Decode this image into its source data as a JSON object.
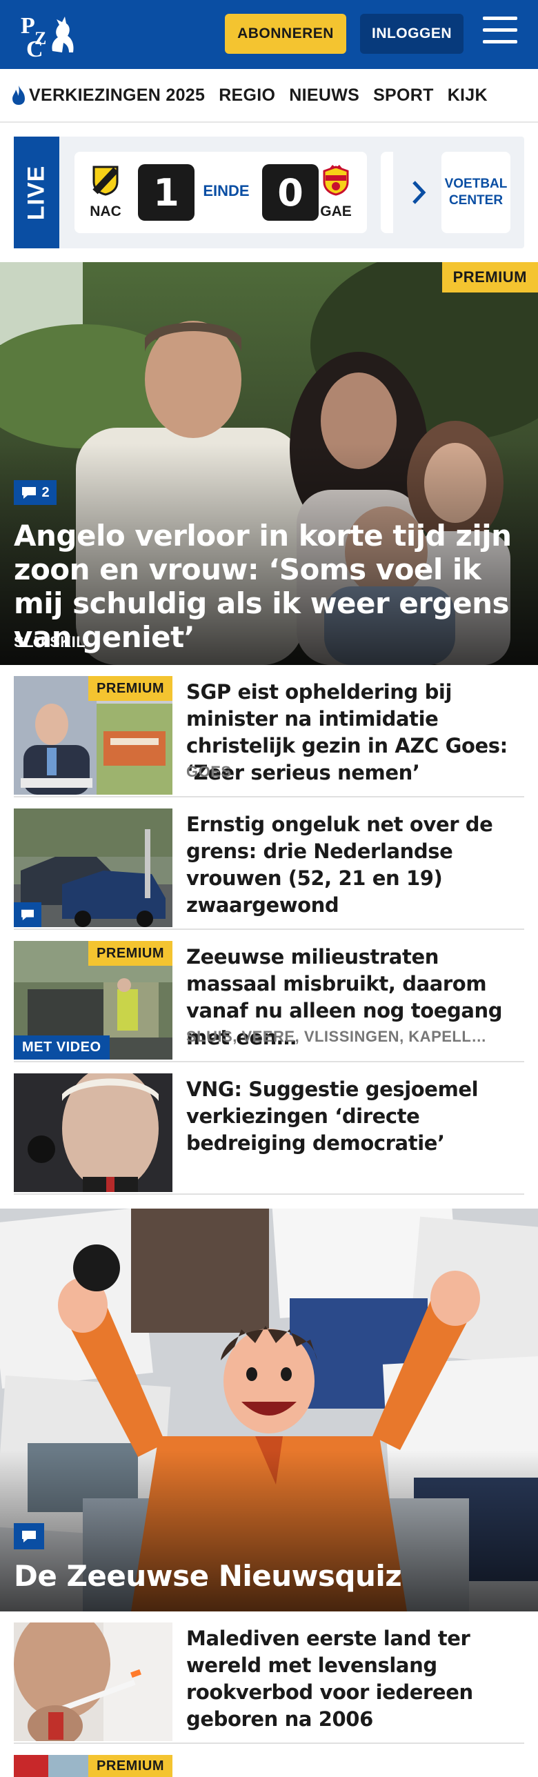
{
  "header": {
    "logo_text": "PZC",
    "subscribe_label": "ABONNEREN",
    "login_label": "INLOGGEN",
    "colors": {
      "brand_blue": "#0a4ea3",
      "accent_yellow": "#f4c430"
    }
  },
  "nav": {
    "items": [
      {
        "label": "VERKIEZINGEN 2025",
        "icon": "flame-icon"
      },
      {
        "label": "REGIO"
      },
      {
        "label": "NIEUWS"
      },
      {
        "label": "SPORT"
      },
      {
        "label": "KIJK"
      }
    ]
  },
  "live": {
    "label": "LIVE",
    "home_team": "NAC",
    "home_score": "1",
    "status": "EINDE",
    "away_score": "0",
    "away_team": "GAE",
    "voetbal_center_label": "VOETBAL CENTER"
  },
  "hero": {
    "badge": "PREMIUM",
    "comment_count": "2",
    "title": "Angelo verloor in korte tijd zijn zoon en vrouw: ‘Soms voel ik mij schuldig als ik weer ergens van geniet’",
    "location": "SLUISKIL"
  },
  "articles": [
    {
      "title": "SGP eist opheldering bij minister na intimidatie christelijk gezin in AZC Goes: ‘Zeer serieus nemen’",
      "location": "GOES",
      "premium": "PREMIUM"
    },
    {
      "title": "Ernstig ongeluk net over de grens: drie Nederlandse vrouwen (52, 21 en 19) zwaargewond"
    },
    {
      "title": "Zeeuwse milieustraten massaal misbruikt, daarom vanaf nu alleen nog toegang met een…",
      "location": "SLUIS, VEERE, VLISSINGEN, KAPELL…",
      "premium": "PREMIUM",
      "video_tag": "MET VIDEO"
    },
    {
      "title": "VNG: Suggestie gesjoemel verkiezingen ‘directe bedreiging democratie’"
    }
  ],
  "quiz": {
    "title": "De Zeeuwse Nieuwsquiz"
  },
  "articles2": [
    {
      "title": "Malediven eerste land ter wereld met levenslang rookverbod voor iedereen geboren na 2006"
    },
    {
      "premium": "PREMIUM"
    }
  ]
}
